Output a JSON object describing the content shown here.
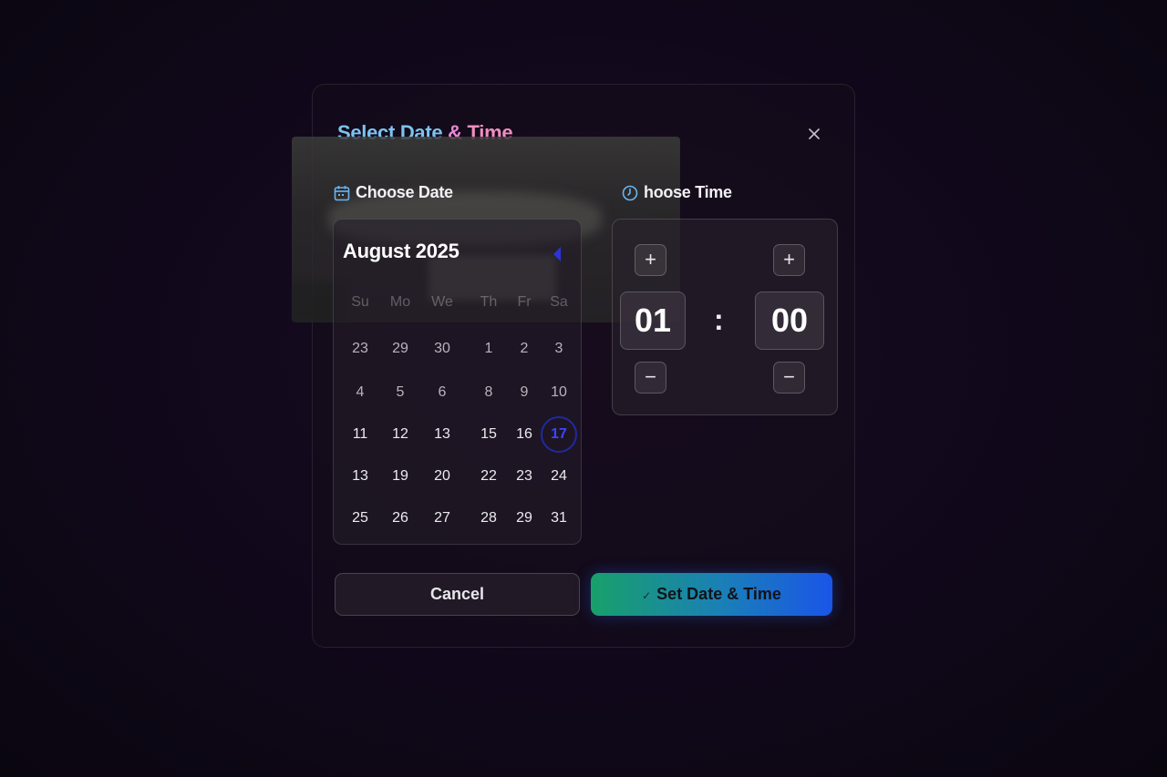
{
  "dialog": {
    "title_part1": "Select Date",
    "title_amp": " & ",
    "title_part2": "Time",
    "close_icon": "close-icon"
  },
  "date_section": {
    "label": "Choose Date",
    "icon": "calendar-icon",
    "month_label": "August 2025",
    "nav_icon": "chevron-left-icon",
    "weekdays": [
      "Su",
      "Mo",
      "We",
      "Th",
      "Fr",
      "Sa"
    ],
    "weeks": [
      [
        "23",
        "29",
        "30",
        "1",
        "2",
        "3"
      ],
      [
        "4",
        "5",
        "6",
        "8",
        "9",
        "10"
      ],
      [
        "11",
        "12",
        "13",
        "15",
        "16",
        "17"
      ],
      [
        "13",
        "19",
        "20",
        "22",
        "23",
        "24"
      ],
      [
        "25",
        "26",
        "27",
        "28",
        "29",
        "31"
      ]
    ],
    "selected_day": "17",
    "selected_color": "#3a46ff"
  },
  "time_section": {
    "label": "hoose Time",
    "icon": "clock-icon",
    "hours": "01",
    "minutes": "00",
    "separator": ":",
    "increment_label": "+",
    "decrement_label": "−"
  },
  "actions": {
    "cancel_label": "Cancel",
    "set_label": "Set Date & Time",
    "set_icon": "check-icon",
    "set_gradient": [
      "#18a06a",
      "#1a55e8"
    ]
  }
}
